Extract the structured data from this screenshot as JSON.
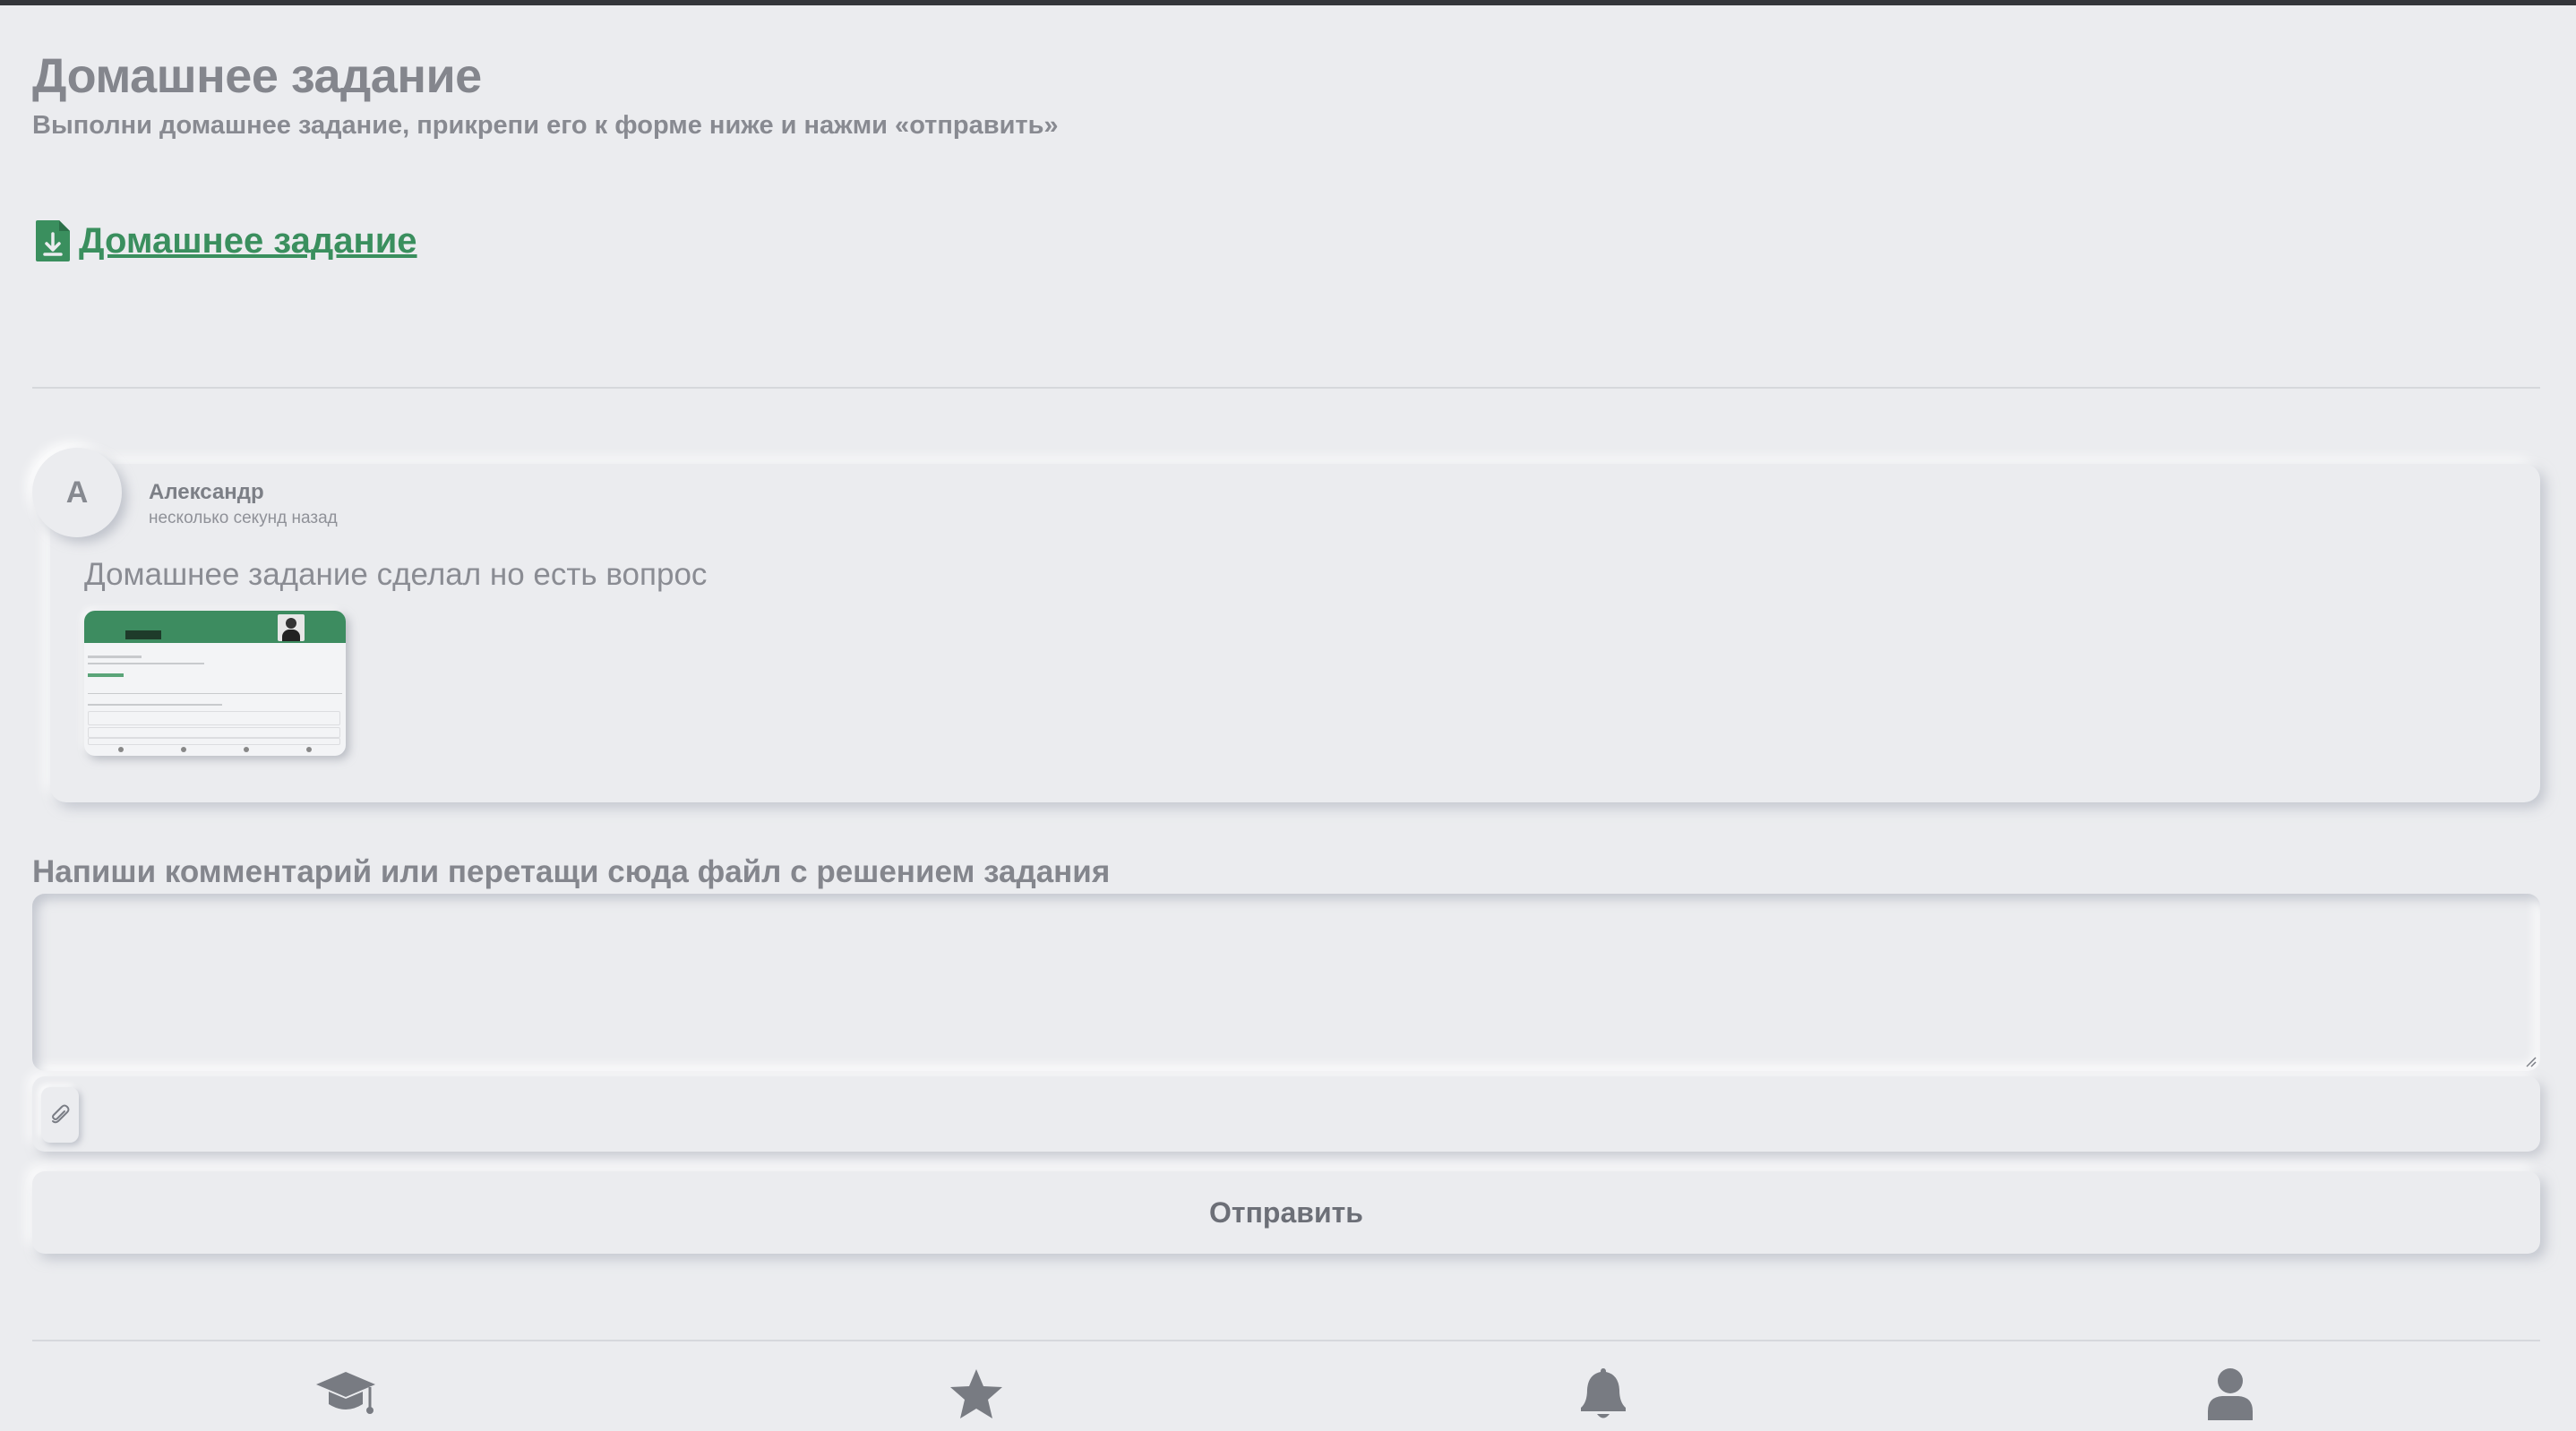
{
  "header": {
    "title": "Домашнее задание",
    "subtitle": "Выполни домашнее задание, прикрепи его к форме ниже и нажми «отправить»"
  },
  "homework_link": {
    "label": "Домашнее задание",
    "icon": "file-download-icon"
  },
  "comment": {
    "avatar_letter": "А",
    "author": "Александр",
    "time": "несколько секунд назад",
    "text": "Домашнее задание сделал но есть вопрос",
    "attachment": "screenshot-thumbnail"
  },
  "form": {
    "label": "Напиши комментарий или перетащи сюда файл с решением задания",
    "comment_value": "",
    "attach_icon": "paperclip-icon",
    "submit_label": "Отправить"
  },
  "bottom_nav": [
    {
      "icon": "graduation-cap-icon"
    },
    {
      "icon": "star-icon"
    },
    {
      "icon": "bell-icon"
    },
    {
      "icon": "user-icon"
    }
  ],
  "colors": {
    "background": "#ebecef",
    "accent_green": "#3a8f5e",
    "text_gray": "#84868d"
  }
}
